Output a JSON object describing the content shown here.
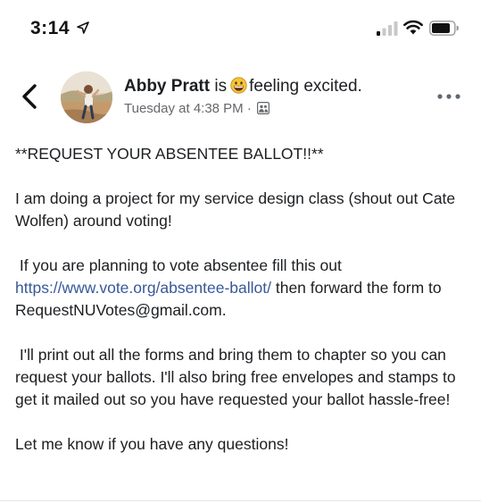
{
  "status_bar": {
    "time": "3:14"
  },
  "post": {
    "author": "Abby Pratt",
    "is_text": "is",
    "feeling_text": "feeling excited.",
    "timestamp": "Tuesday at 4:38 PM",
    "meta_separator": "·",
    "headline": "**REQUEST YOUR ABSENTEE BALLOT!!**",
    "paragraph_1": "I am doing a project for my service design class (shout out Cate Wolfen) around voting!",
    "paragraph_2_before_link": "If you are planning to vote absentee fill this out",
    "link": "https://www.vote.org/absentee-ballot/",
    "paragraph_2_after_link": "then forward the form to RequestNUVotes@gmail.com.",
    "paragraph_3": "I'll print out all the forms and bring them to chapter so you can request your ballots. I'll also bring free envelopes and stamps to get it mailed out so you have requested your ballot hassle-free!",
    "paragraph_4": "Let me know if you have any questions!"
  },
  "icons": {
    "back": "chevron-left-icon",
    "more": "more-horizontal-icon",
    "feeling": "grinning-face-icon",
    "privacy": "friends-audience-icon",
    "location": "location-arrow-icon"
  },
  "colors": {
    "link": "#385898",
    "meta": "#65676b",
    "text": "#1c1e21",
    "emoji": "#f7c33a"
  }
}
